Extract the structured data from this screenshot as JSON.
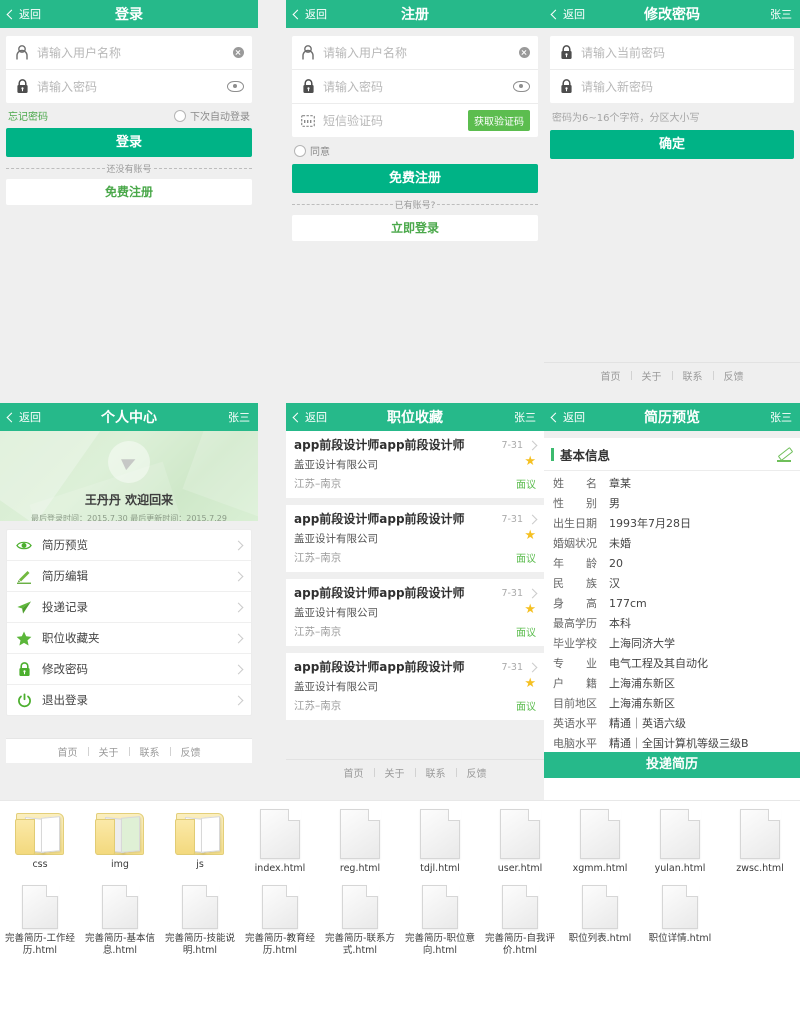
{
  "common": {
    "back_label": "返回",
    "user_name": "张三",
    "bottom_nav": [
      "首页",
      "关于",
      "联系",
      "反馈"
    ]
  },
  "login": {
    "title": "登录",
    "username_placeholder": "请输入用户名称",
    "password_placeholder": "请输入密码",
    "forgot_password": "忘记密码",
    "auto_login": "下次自动登录",
    "login_button": "登录",
    "separator": "还没有账号",
    "register_button": "免费注册"
  },
  "register": {
    "title": "注册",
    "username_placeholder": "请输入用户名称",
    "password_placeholder": "请输入密码",
    "sms_placeholder": "短信验证码",
    "get_code_button": "获取验证码",
    "agree_label": "同意",
    "register_button": "免费注册",
    "separator": "已有账号?",
    "login_button": "立即登录"
  },
  "change_password": {
    "title": "修改密码",
    "current_placeholder": "请输入当前密码",
    "new_placeholder": "请输入新密码",
    "hint": "密码为6~16个字符，分区大小写",
    "confirm_button": "确定"
  },
  "personal_center": {
    "title": "个人中心",
    "welcome": "王丹丹 欢迎回来",
    "last_info": "最后登录时间：2015.7.30 最后更新时间：2015.7.29",
    "menu": [
      {
        "icon": "eye-icon",
        "label": "简历预览"
      },
      {
        "icon": "pencil-icon",
        "label": "简历编辑"
      },
      {
        "icon": "paper-plane-icon",
        "label": "投递记录"
      },
      {
        "icon": "star-icon",
        "label": "职位收藏夹"
      },
      {
        "icon": "lock-icon",
        "label": "修改密码"
      },
      {
        "icon": "power-icon",
        "label": "退出登录"
      }
    ]
  },
  "job_collection": {
    "title": "职位收藏",
    "items": [
      {
        "title": "app前段设计师app前段设计师",
        "date": "7-31",
        "company": "盖亚设计有限公司",
        "location": "江苏–南京",
        "salary": "面议"
      },
      {
        "title": "app前段设计师app前段设计师",
        "date": "7-31",
        "company": "盖亚设计有限公司",
        "location": "江苏–南京",
        "salary": "面议"
      },
      {
        "title": "app前段设计师app前段设计师",
        "date": "7-31",
        "company": "盖亚设计有限公司",
        "location": "江苏–南京",
        "salary": "面议"
      },
      {
        "title": "app前段设计师app前段设计师",
        "date": "7-31",
        "company": "盖亚设计有限公司",
        "location": "江苏–南京",
        "salary": "面议"
      }
    ]
  },
  "resume_preview": {
    "title": "简历预览",
    "section_title": "基本信息",
    "fields": [
      {
        "label": "姓　　名",
        "value": "章某"
      },
      {
        "label": "性　　别",
        "value": "男"
      },
      {
        "label": "出生日期",
        "value": "1993年7月28日"
      },
      {
        "label": "婚姻状况",
        "value": "未婚"
      },
      {
        "label": "年　　龄",
        "value": "20"
      },
      {
        "label": "民　　族",
        "value": "汉"
      },
      {
        "label": "身　　高",
        "value": "177cm"
      },
      {
        "label": "最高学历",
        "value": "本科"
      },
      {
        "label": "毕业学校",
        "value": "上海同济大学"
      },
      {
        "label": "专　　业",
        "value": "电气工程及其自动化"
      },
      {
        "label": "户　　籍",
        "value": "上海浦东新区"
      },
      {
        "label": "目前地区",
        "value": "上海浦东新区"
      },
      {
        "label": "英语水平",
        "value": "精通｜英语六级"
      },
      {
        "label": "电脑水平",
        "value": "精通｜全国计算机等级三级B"
      }
    ],
    "submit_button": "投递简历"
  },
  "files": {
    "row1": [
      {
        "name": "css",
        "type": "folder",
        "variant": "plain"
      },
      {
        "name": "img",
        "type": "folder",
        "variant": "image"
      },
      {
        "name": "js",
        "type": "folder",
        "variant": "plain"
      },
      {
        "name": "index.html",
        "type": "html"
      },
      {
        "name": "reg.html",
        "type": "html"
      },
      {
        "name": "tdjl.html",
        "type": "html"
      },
      {
        "name": "user.html",
        "type": "html"
      },
      {
        "name": "xgmm.html",
        "type": "html"
      },
      {
        "name": "yulan.html",
        "type": "html"
      },
      {
        "name": "zwsc.html",
        "type": "html"
      }
    ],
    "row2": [
      {
        "name": "完善简历-工作经历.html",
        "type": "html"
      },
      {
        "name": "完善简历-基本信息.html",
        "type": "html"
      },
      {
        "name": "完善简历-技能说明.html",
        "type": "html"
      },
      {
        "name": "完善简历-教育经历.html",
        "type": "html"
      },
      {
        "name": "完善简历-联系方式.html",
        "type": "html"
      },
      {
        "name": "完善简历-职位意向.html",
        "type": "html"
      },
      {
        "name": "完善简历-自我评价.html",
        "type": "html"
      },
      {
        "name": "职位列表.html",
        "type": "html"
      },
      {
        "name": "职位详情.html",
        "type": "html"
      }
    ]
  },
  "colors": {
    "header_green": "#26b98a",
    "button_green": "#00b386",
    "link_green": "#4aa84a",
    "code_button_green": "#5cbd4f",
    "star_yellow": "#f5c022",
    "page_bg": "#efefef"
  }
}
